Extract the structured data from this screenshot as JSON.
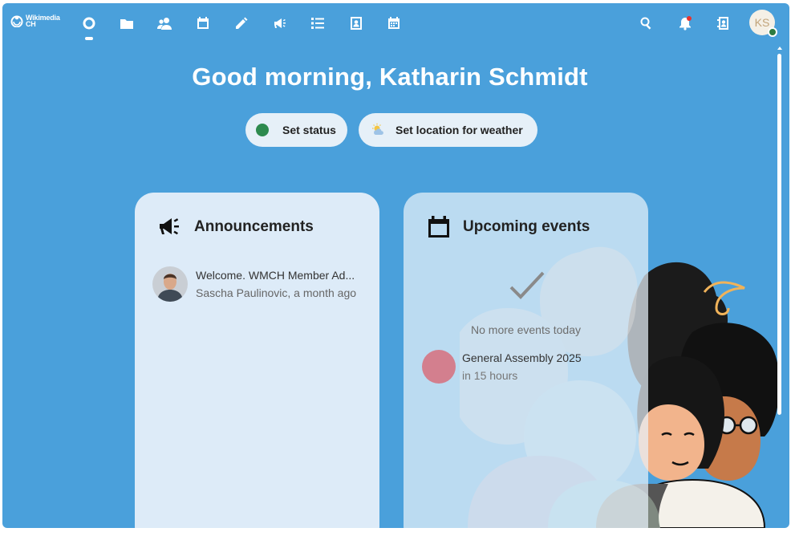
{
  "brand": {
    "line1": "Wikimedia",
    "line2": "CH"
  },
  "nav": {
    "apps": [
      {
        "name": "dashboard"
      },
      {
        "name": "files"
      },
      {
        "name": "contacts-circles"
      },
      {
        "name": "calendar"
      },
      {
        "name": "notes"
      },
      {
        "name": "announcements"
      },
      {
        "name": "tasks"
      },
      {
        "name": "contacts"
      },
      {
        "name": "calendar-view"
      }
    ],
    "active_app": "dashboard"
  },
  "user": {
    "initials": "KS",
    "status": "online"
  },
  "greeting": "Good morning, Katharin Schmidt",
  "actions": {
    "set_status": "Set status",
    "set_weather": "Set location for weather"
  },
  "announcements": {
    "title": "Announcements",
    "items": [
      {
        "title": "Welcome. WMCH Member Ad...",
        "meta": "Sascha Paulinovic, a month ago"
      }
    ]
  },
  "events": {
    "title": "Upcoming events",
    "empty_text": "No more events today",
    "items": [
      {
        "title": "General Assembly 2025",
        "meta": "in 15 hours",
        "color": "#d37f8e"
      }
    ]
  },
  "colors": {
    "background": "#4aa0db",
    "widget": "#e8f1fa",
    "status_online": "#2d8a4e"
  }
}
